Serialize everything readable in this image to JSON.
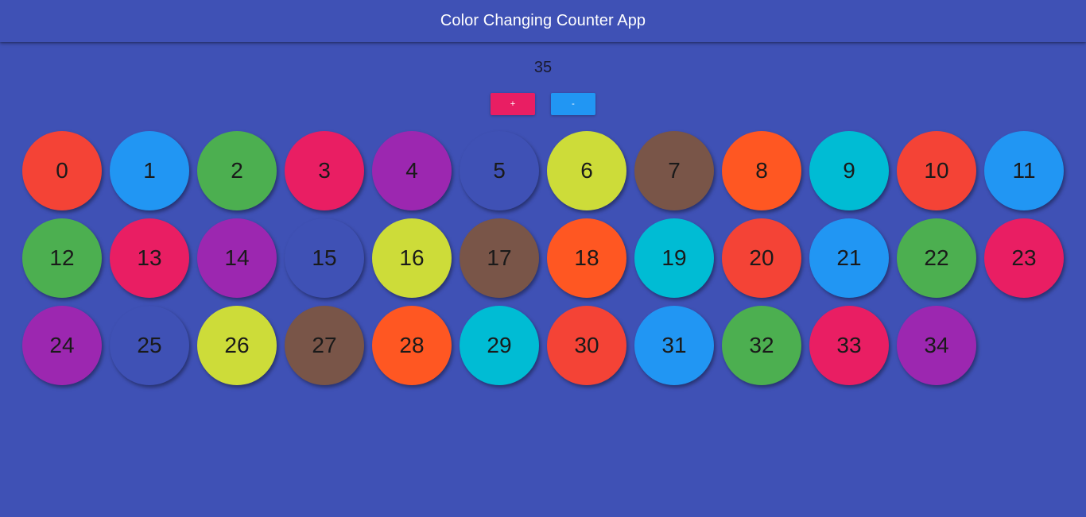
{
  "app_bar": {
    "title": "Color Changing Counter App"
  },
  "counter": {
    "value": "35"
  },
  "controls": {
    "increment_label": "+",
    "decrement_label": "-",
    "increment_color": "#e91e63",
    "decrement_color": "#2196f3"
  },
  "colors": {
    "background": "#3f51b5",
    "palette": [
      "#f44336",
      "#2196f3",
      "#4caf50",
      "#e91e63",
      "#9c27b0",
      "#3f51b5",
      "#cddc39",
      "#795548",
      "#ff5722",
      "#00bcd4"
    ]
  },
  "circles": [
    {
      "label": "0",
      "color": "#f44336"
    },
    {
      "label": "1",
      "color": "#2196f3"
    },
    {
      "label": "2",
      "color": "#4caf50"
    },
    {
      "label": "3",
      "color": "#e91e63"
    },
    {
      "label": "4",
      "color": "#9c27b0"
    },
    {
      "label": "5",
      "color": "#3f51b5"
    },
    {
      "label": "6",
      "color": "#cddc39"
    },
    {
      "label": "7",
      "color": "#795548"
    },
    {
      "label": "8",
      "color": "#ff5722"
    },
    {
      "label": "9",
      "color": "#00bcd4"
    },
    {
      "label": "10",
      "color": "#f44336"
    },
    {
      "label": "11",
      "color": "#2196f3"
    },
    {
      "label": "12",
      "color": "#4caf50"
    },
    {
      "label": "13",
      "color": "#e91e63"
    },
    {
      "label": "14",
      "color": "#9c27b0"
    },
    {
      "label": "15",
      "color": "#3f51b5"
    },
    {
      "label": "16",
      "color": "#cddc39"
    },
    {
      "label": "17",
      "color": "#795548"
    },
    {
      "label": "18",
      "color": "#ff5722"
    },
    {
      "label": "19",
      "color": "#00bcd4"
    },
    {
      "label": "20",
      "color": "#f44336"
    },
    {
      "label": "21",
      "color": "#2196f3"
    },
    {
      "label": "22",
      "color": "#4caf50"
    },
    {
      "label": "23",
      "color": "#e91e63"
    },
    {
      "label": "24",
      "color": "#9c27b0"
    },
    {
      "label": "25",
      "color": "#3f51b5"
    },
    {
      "label": "26",
      "color": "#cddc39"
    },
    {
      "label": "27",
      "color": "#795548"
    },
    {
      "label": "28",
      "color": "#ff5722"
    },
    {
      "label": "29",
      "color": "#00bcd4"
    },
    {
      "label": "30",
      "color": "#f44336"
    },
    {
      "label": "31",
      "color": "#2196f3"
    },
    {
      "label": "32",
      "color": "#4caf50"
    },
    {
      "label": "33",
      "color": "#e91e63"
    },
    {
      "label": "34",
      "color": "#9c27b0"
    }
  ]
}
